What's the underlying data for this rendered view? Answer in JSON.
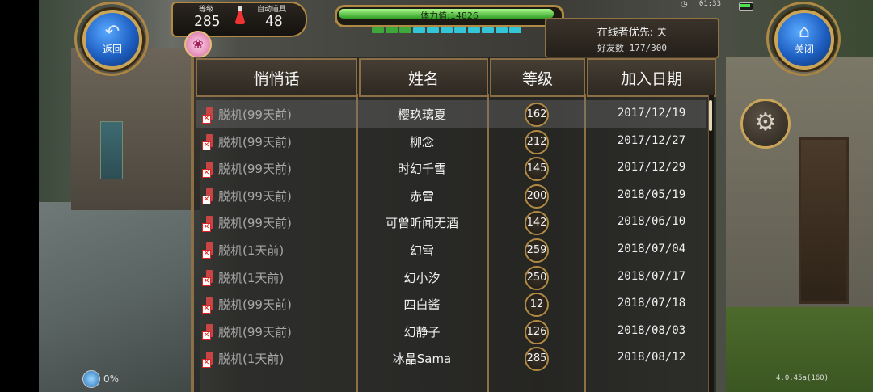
{
  "hud": {
    "back_label": "返回",
    "close_label": "关闭",
    "level_label": "等级",
    "level_value": "285",
    "auto_item_label": "自动道具",
    "auto_item_value": "48",
    "stamina_text": "体力值:14826",
    "stamina_fraction": 0.97,
    "clock": "01:33",
    "loading_percent": "0%",
    "version": "4.0.45a(160)"
  },
  "friends": {
    "online_priority": "在线者优先: 关",
    "friend_count": "好友数 177/300",
    "columns": [
      "悄悄话",
      "姓名",
      "等级",
      "加入日期"
    ],
    "rows": [
      {
        "status": "脱机(99天前)",
        "name": "樱玖璃夏",
        "level": "162",
        "date": "2017/12/19"
      },
      {
        "status": "脱机(99天前)",
        "name": "柳念",
        "level": "212",
        "date": "2017/12/27"
      },
      {
        "status": "脱机(99天前)",
        "name": "时幻千雪",
        "level": "145",
        "date": "2017/12/29"
      },
      {
        "status": "脱机(99天前)",
        "name": "赤雷",
        "level": "200",
        "date": "2018/05/19"
      },
      {
        "status": "脱机(99天前)",
        "name": "可曾听闻无酒",
        "level": "142",
        "date": "2018/06/10"
      },
      {
        "status": "脱机(1天前)",
        "name": "幻雪",
        "level": "259",
        "date": "2018/07/04"
      },
      {
        "status": "脱机(1天前)",
        "name": "幻小汐",
        "level": "250",
        "date": "2018/07/17"
      },
      {
        "status": "脱机(99天前)",
        "name": "四白酱",
        "level": "12",
        "date": "2018/07/18"
      },
      {
        "status": "脱机(99天前)",
        "name": "幻静子",
        "level": "126",
        "date": "2018/08/03"
      },
      {
        "status": "脱机(1天前)",
        "name": "冰晶Sama",
        "level": "285",
        "date": "2018/08/12"
      }
    ]
  }
}
